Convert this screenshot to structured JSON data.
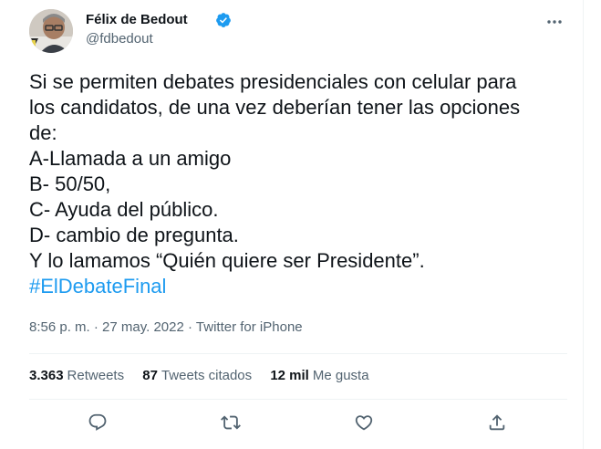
{
  "user": {
    "display_name": "Félix de Bedout",
    "handle": "@fdbedout",
    "verified": true
  },
  "tweet": {
    "lines": [
      "Si se permiten debates presidenciales con celular para",
      "los candidatos, de una vez deberían tener las opciones",
      "de:",
      "A-Llamada a un amigo",
      "B- 50/50,",
      "C- Ayuda del público.",
      "D- cambio de pregunta.",
      "Y lo lamamos “Quién quiere ser Presidente”."
    ],
    "hashtag": "#ElDebateFinal"
  },
  "meta": {
    "time": "8:56 p. m.",
    "separator": "·",
    "date": "27 may. 2022",
    "source": "Twitter for iPhone"
  },
  "stats": {
    "retweets_count": "3.363",
    "retweets_label": "Retweets",
    "quotes_count": "87",
    "quotes_label": "Tweets citados",
    "likes_count": "12 mil",
    "likes_label": "Me gusta"
  },
  "colors": {
    "accent": "#1d9bf0",
    "text": "#0f1419",
    "muted": "#536471",
    "divider": "#eff3f4"
  },
  "icons": {
    "verified": "verified-badge-icon",
    "more": "more-dots-icon",
    "reply": "reply-bubble-icon",
    "retweet": "retweet-icon",
    "like": "heart-icon",
    "share": "share-upload-icon"
  }
}
